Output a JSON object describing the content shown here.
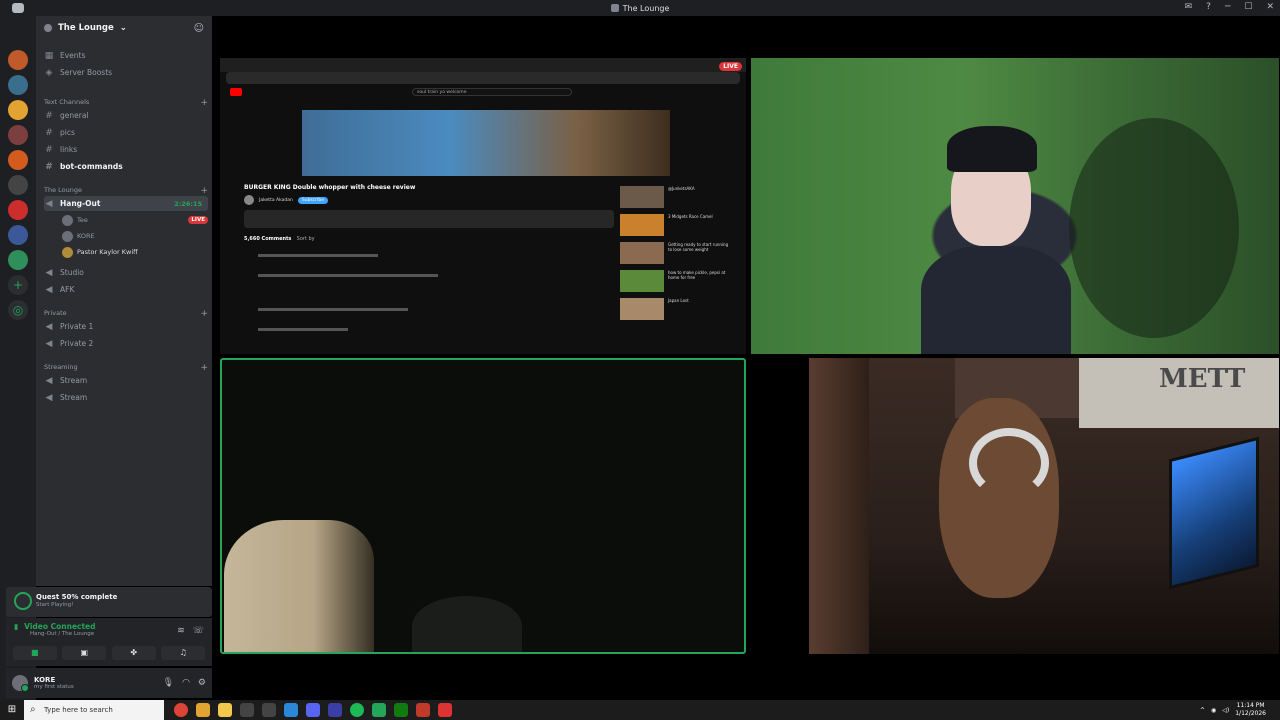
{
  "window": {
    "title": "The Lounge",
    "controls": [
      "─",
      "☐",
      "✕"
    ]
  },
  "server": {
    "name": "The Lounge",
    "chevron": "⌄"
  },
  "top_items": [
    {
      "label": "Events",
      "icon": "calendar-icon"
    },
    {
      "label": "Server Boosts",
      "icon": "boost-icon"
    }
  ],
  "categories": {
    "text": "Text Channels",
    "lounge": "The Lounge",
    "private": "Private",
    "streaming": "Streaming"
  },
  "text_channels": [
    "general",
    "pics",
    "links",
    "bot-commands"
  ],
  "voice": {
    "active_channel": "Hang-Out",
    "timer": "2:26:15",
    "users": [
      {
        "name": "Tee",
        "live": "LIVE"
      },
      {
        "name": "KORE",
        "live": ""
      },
      {
        "name": "Pastor Kaylor Kwiff",
        "live": ""
      }
    ],
    "other_channels": [
      "Studio",
      "AFK"
    ],
    "private_channels": [
      "Private 1",
      "Private 2"
    ],
    "streaming_channels": [
      "Stream",
      "Stream"
    ]
  },
  "quest": {
    "title": "Quest 50% complete",
    "subtitle": "Start Playing!",
    "progress": 0.5
  },
  "voice_status": {
    "label": "Video Connected",
    "channel": "Hang-Out / The Lounge"
  },
  "user": {
    "name": "KORE",
    "status": "my first status"
  },
  "stream": {
    "live_badge": "LIVE",
    "video_title": "BURGER KING Double whopper with cheese review",
    "channel_name": "Jaketta Akadan",
    "subscribe_label": "Subscribe",
    "comments_label": "5,660 Comments",
    "sort_label": "Sort by",
    "search_query": "soul train yo welcome",
    "rec_titles": [
      "@JunketsAKA",
      "3 Midgets Race Camel",
      "Getting ready to start running to lose some weight",
      "how to make pickle, pepsi at home for free",
      "Japan Lost"
    ]
  },
  "cam3_sign": "METT",
  "taskbar": {
    "search_placeholder": "Type here to search",
    "time": "11:14 PM",
    "date": "1/12/2026"
  },
  "colors": {
    "accent_green": "#23a55a",
    "live_red": "#da373c",
    "sidebar_bg": "#2b2d31"
  }
}
